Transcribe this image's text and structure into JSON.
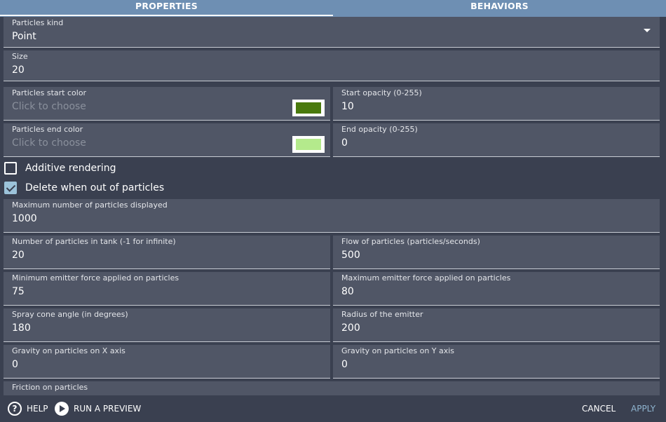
{
  "tabs": [
    {
      "label": "PROPERTIES",
      "active": true
    },
    {
      "label": "BEHAVIORS",
      "active": false
    }
  ],
  "particles_kind": {
    "label": "Particles kind",
    "value": "Point"
  },
  "size": {
    "label": "Size",
    "value": "20"
  },
  "start_color": {
    "label": "Particles start color",
    "placeholder": "Click to choose",
    "color": "#4a7a0e"
  },
  "start_opacity": {
    "label": "Start opacity (0-255)",
    "value": "10"
  },
  "end_color": {
    "label": "Particles end color",
    "placeholder": "Click to choose",
    "color": "#b4ea8c"
  },
  "end_opacity": {
    "label": "End opacity (0-255)",
    "value": "0"
  },
  "additive_rendering": {
    "label": "Additive rendering",
    "checked": false
  },
  "delete_when_out": {
    "label": "Delete when out of particles",
    "checked": true
  },
  "max_particles": {
    "label": "Maximum number of particles displayed",
    "value": "1000"
  },
  "tank": {
    "label": "Number of particles in tank (-1 for infinite)",
    "value": "20"
  },
  "flow": {
    "label": "Flow of particles (particles/seconds)",
    "value": "500"
  },
  "min_force": {
    "label": "Minimum emitter force applied on particles",
    "value": "75"
  },
  "max_force": {
    "label": "Maximum emitter force applied on particles",
    "value": "80"
  },
  "spray_cone": {
    "label": "Spray cone angle (in degrees)",
    "value": "180"
  },
  "radius": {
    "label": "Radius of the emitter",
    "value": "200"
  },
  "gravity_x": {
    "label": "Gravity on particles on X axis",
    "value": "0"
  },
  "gravity_y": {
    "label": "Gravity on particles on Y axis",
    "value": "0"
  },
  "friction": {
    "label": "Friction on particles"
  },
  "footer": {
    "help_label": "HELP",
    "help_icon": "?",
    "preview_label": "RUN A PREVIEW",
    "cancel_label": "CANCEL",
    "apply_label": "APPLY"
  }
}
